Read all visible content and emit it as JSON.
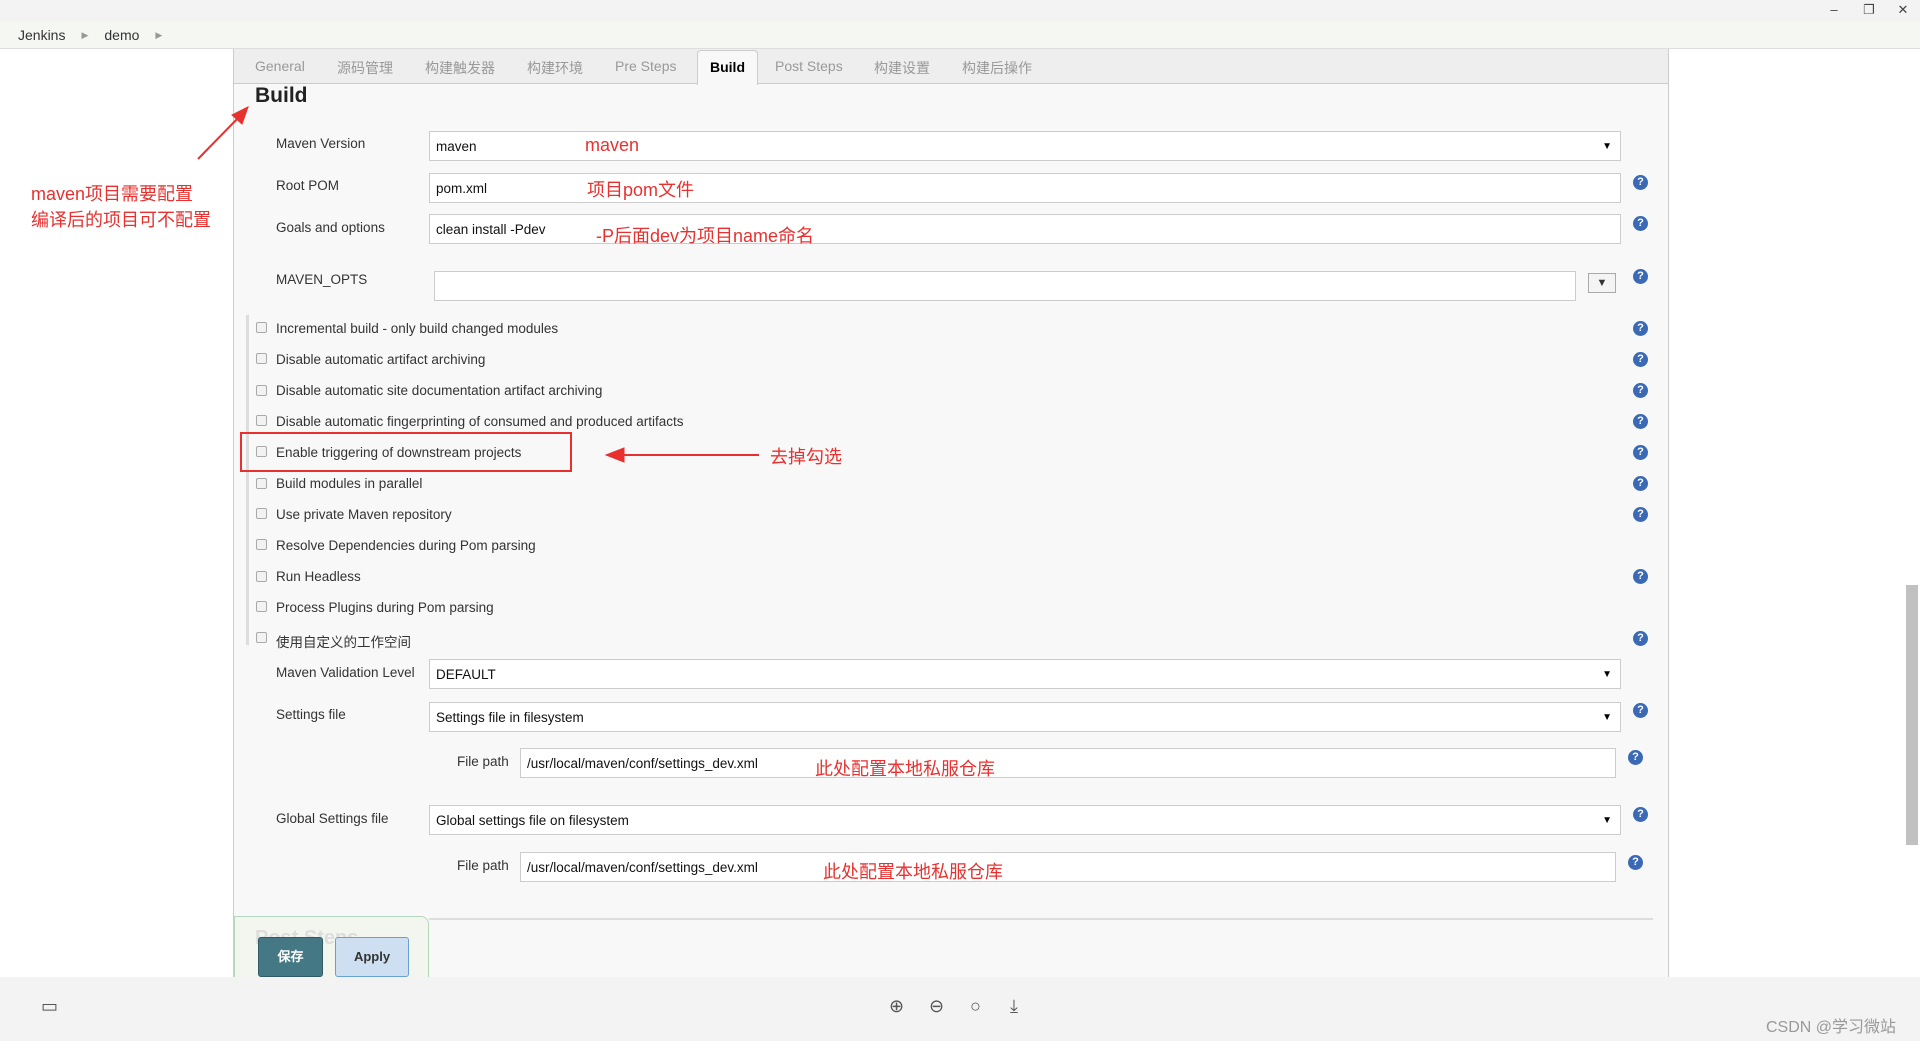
{
  "window": {
    "minimize": "–",
    "restore": "❐",
    "close": "✕"
  },
  "breadcrumb": [
    "Jenkins",
    "demo"
  ],
  "tabs": [
    "General",
    "源码管理",
    "构建触发器",
    "构建环境",
    "Pre Steps",
    "Build",
    "Post Steps",
    "构建设置",
    "构建后操作"
  ],
  "active_tab": "Build",
  "section_title": "Build",
  "form": {
    "maven_version": {
      "label": "Maven Version",
      "value": "maven"
    },
    "root_pom": {
      "label": "Root POM",
      "value": "pom.xml"
    },
    "goals": {
      "label": "Goals and options",
      "value": "clean install -Pdev"
    },
    "maven_opts": {
      "label": "MAVEN_OPTS",
      "value": ""
    },
    "checkboxes": [
      {
        "label": "Incremental build - only build changed modules",
        "checked": false
      },
      {
        "label": "Disable automatic artifact archiving",
        "checked": false
      },
      {
        "label": "Disable automatic site documentation artifact archiving",
        "checked": false
      },
      {
        "label": "Disable automatic fingerprinting of consumed and produced artifacts",
        "checked": false
      },
      {
        "label": "Enable triggering of downstream projects",
        "checked": false
      },
      {
        "label": "Build modules in parallel",
        "checked": false
      },
      {
        "label": "Use private Maven repository",
        "checked": false
      },
      {
        "label": "Resolve Dependencies during Pom parsing",
        "checked": false
      },
      {
        "label": "Run Headless",
        "checked": false
      },
      {
        "label": "Process Plugins during Pom parsing",
        "checked": false
      },
      {
        "label": "使用自定义的工作空间",
        "checked": false
      }
    ],
    "validation_level": {
      "label": "Maven Validation Level",
      "value": "DEFAULT"
    },
    "settings_file": {
      "label": "Settings file",
      "value": "Settings file in filesystem",
      "file_path_label": "File path",
      "file_path": "/usr/local/maven/conf/settings_dev.xml"
    },
    "global_settings_file": {
      "label": "Global Settings file",
      "value": "Global settings file on filesystem",
      "file_path_label": "File path",
      "file_path": "/usr/local/maven/conf/settings_dev.xml"
    }
  },
  "next_section": "Post Steps",
  "buttons": {
    "save": "保存",
    "apply": "Apply"
  },
  "annotations": {
    "left_note_1": "maven项目需要配置",
    "left_note_2": "编译后的项目可不配置",
    "maven": "maven",
    "pom": "项目pom文件",
    "goals": "-P后面dev为项目name命名",
    "uncheck": "去掉勾选",
    "settings": "此处配置本地私服仓库",
    "global_settings": "此处配置本地私服仓库"
  },
  "watermark": "CSDN @学习微站",
  "colors": {
    "annotation": "#e8312f",
    "save": "#457885",
    "apply": "#cddff0",
    "help": "#3a6ab5"
  }
}
